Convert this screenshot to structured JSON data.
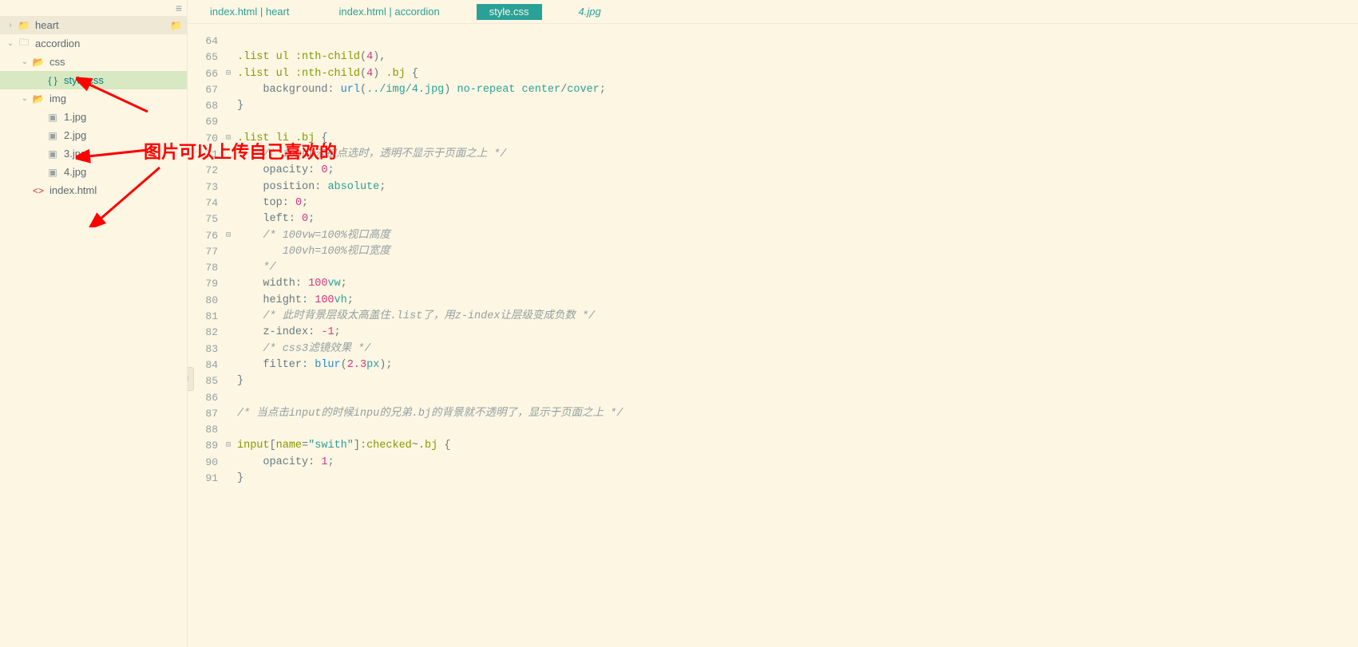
{
  "sidebar": {
    "items": [
      {
        "indent": 0,
        "twist": "›",
        "iconClass": "folder-icon",
        "icon": "📁",
        "label": "heart",
        "selected": false,
        "highlighted": true,
        "rightFolder": true
      },
      {
        "indent": 0,
        "twist": "⌄",
        "iconClass": "folder-icon-grey",
        "icon": "🗀",
        "label": "accordion",
        "selected": false
      },
      {
        "indent": 1,
        "twist": "⌄",
        "iconClass": "folder-open",
        "icon": "📂",
        "label": "css",
        "selected": false
      },
      {
        "indent": 2,
        "twist": "",
        "iconClass": "cssfile",
        "icon": "{ }",
        "label": "style.css",
        "selected": true
      },
      {
        "indent": 1,
        "twist": "⌄",
        "iconClass": "folder-open",
        "icon": "📂",
        "label": "img",
        "selected": false
      },
      {
        "indent": 2,
        "twist": "",
        "iconClass": "imgfile",
        "icon": "▣",
        "label": "1.jpg",
        "selected": false
      },
      {
        "indent": 2,
        "twist": "",
        "iconClass": "imgfile",
        "icon": "▣",
        "label": "2.jpg",
        "selected": false
      },
      {
        "indent": 2,
        "twist": "",
        "iconClass": "imgfile",
        "icon": "▣",
        "label": "3.jpg",
        "selected": false
      },
      {
        "indent": 2,
        "twist": "",
        "iconClass": "imgfile",
        "icon": "▣",
        "label": "4.jpg",
        "selected": false
      },
      {
        "indent": 1,
        "twist": "",
        "iconClass": "htmlfile",
        "icon": "<>",
        "label": "index.html",
        "selected": false
      }
    ]
  },
  "tabs": [
    {
      "label": "index.html | heart",
      "active": false,
      "italic": false
    },
    {
      "label": "index.html | accordion",
      "active": false,
      "italic": false
    },
    {
      "label": "style.css",
      "active": true,
      "italic": false
    },
    {
      "label": "4.jpg",
      "active": false,
      "italic": true
    }
  ],
  "code": {
    "startLine": 64,
    "fold": {
      "66": "⊟",
      "70": "⊟",
      "76": "⊟",
      "89": "⊟"
    },
    "lines": [
      {
        "html": ""
      },
      {
        "html": "<span class='sel'>.list</span> <span class='sel'>ul</span> <span class='sel'>:nth-child</span><span class='punct'>(</span><span class='num'>4</span><span class='punct'>),</span>"
      },
      {
        "html": "<span class='sel'>.list</span> <span class='sel'>ul</span> <span class='sel'>:nth-child</span><span class='punct'>(</span><span class='num'>4</span><span class='punct'>)</span> <span class='sel'>.bj</span> <span class='punct'>{</span>"
      },
      {
        "html": "    <span class='prop'>background</span><span class='punct'>:</span> <span class='func'>url</span><span class='punct'>(</span><span class='str'>../img/4.jpg</span><span class='punct'>)</span> <span class='str'>no-repeat</span> <span class='str'>center</span><span class='punct'>/</span><span class='str'>cover</span><span class='punct'>;</span>"
      },
      {
        "html": "<span class='punct'>}</span>"
      },
      {
        "html": ""
      },
      {
        "html": "<span class='sel'>.list</span> <span class='sel'>li</span> <span class='sel'>.bj</span> <span class='punct'>{</span>"
      },
      {
        "html": "    <span class='comment'>/* input未被点选时，透明不显示于页面之上 */</span>"
      },
      {
        "html": "    <span class='prop'>opacity</span><span class='punct'>:</span> <span class='num'>0</span><span class='punct'>;</span>"
      },
      {
        "html": "    <span class='prop'>position</span><span class='punct'>:</span> <span class='str'>absolute</span><span class='punct'>;</span>"
      },
      {
        "html": "    <span class='prop'>top</span><span class='punct'>:</span> <span class='num'>0</span><span class='punct'>;</span>"
      },
      {
        "html": "    <span class='prop'>left</span><span class='punct'>:</span> <span class='num'>0</span><span class='punct'>;</span>"
      },
      {
        "html": "    <span class='comment'>/* 100vw=100%视口高度</span>"
      },
      {
        "html": "    <span class='comment'>   100vh=100%视口宽度</span>"
      },
      {
        "html": "    <span class='comment'>*/</span>"
      },
      {
        "html": "    <span class='prop'>width</span><span class='punct'>:</span> <span class='num'>100</span><span class='str'>vw</span><span class='punct'>;</span>"
      },
      {
        "html": "    <span class='prop'>height</span><span class='punct'>:</span> <span class='num'>100</span><span class='str'>vh</span><span class='punct'>;</span>"
      },
      {
        "html": "    <span class='comment'>/* 此时背景层级太高盖住.list了，用z-index让层级变成负数 */</span>"
      },
      {
        "html": "    <span class='prop'>z-index</span><span class='punct'>:</span> <span class='num'>-1</span><span class='punct'>;</span>"
      },
      {
        "html": "    <span class='comment'>/* css3滤镜效果 */</span>"
      },
      {
        "html": "    <span class='prop'>filter</span><span class='punct'>:</span> <span class='func'>blur</span><span class='punct'>(</span><span class='num'>2.3</span><span class='str'>px</span><span class='punct'>);</span>"
      },
      {
        "html": "<span class='punct'>}</span>"
      },
      {
        "html": ""
      },
      {
        "html": "<span class='comment'>/* 当点击input的时候inpu的兄弟.bj的背景就不透明了，显示于页面之上 */</span>"
      },
      {
        "html": ""
      },
      {
        "html": "<span class='sel'>input</span><span class='punct'>[</span><span class='sel'>name</span><span class='punct'>=</span><span class='str'>\"swith\"</span><span class='punct'>]</span><span class='sel'>:checked</span><span class='punct'>~</span><span class='sel'>.bj</span> <span class='punct'>{</span>"
      },
      {
        "html": "    <span class='prop'>opacity</span><span class='punct'>:</span> <span class='num'>1</span><span class='punct'>;</span>"
      },
      {
        "html": "<span class='punct'>}</span>"
      }
    ]
  },
  "annotation": {
    "text": "图片可以上传自己喜欢的"
  }
}
